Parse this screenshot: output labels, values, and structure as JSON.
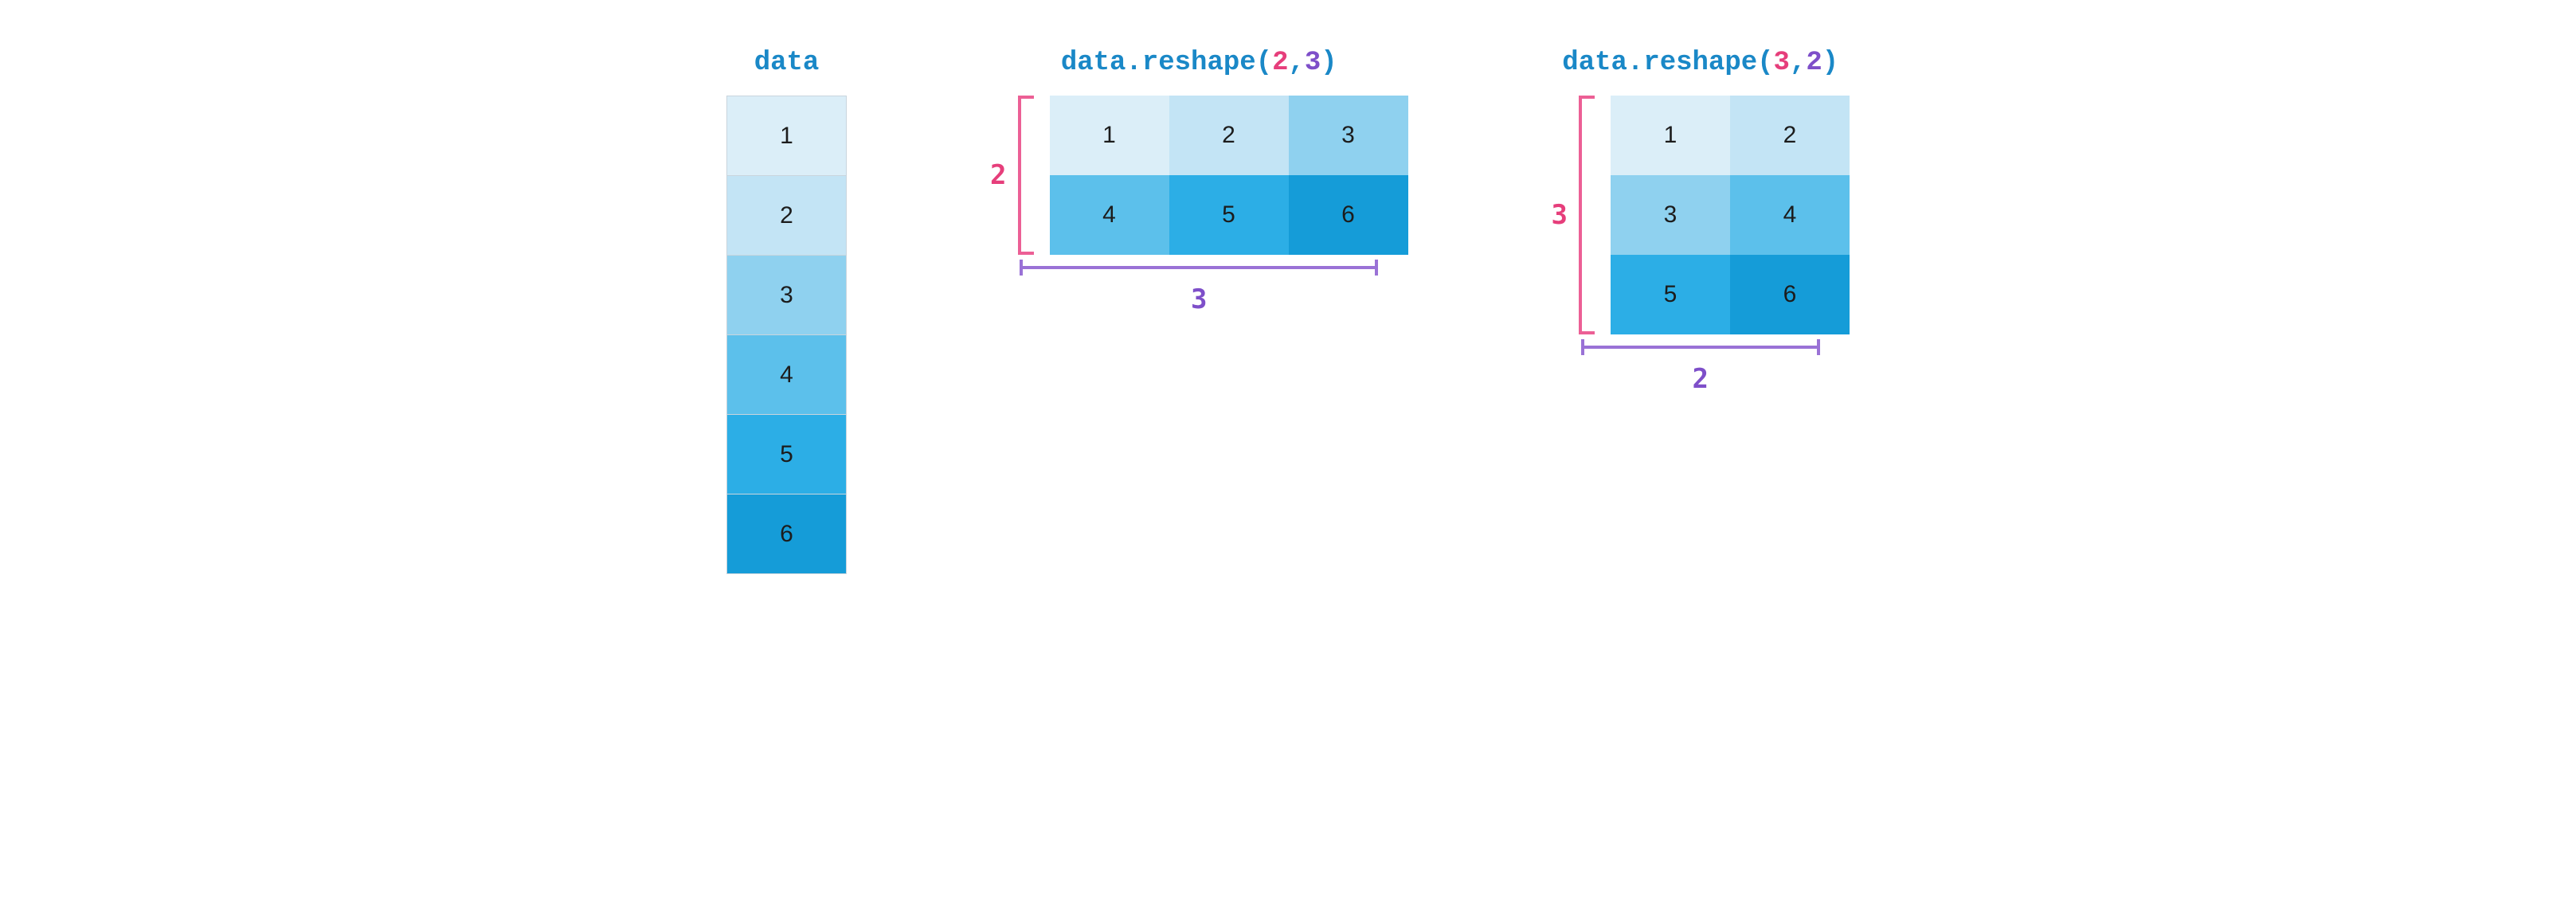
{
  "palette": {
    "code_blue": "#1a88c7",
    "pink": "#e63e7b",
    "purple": "#7e4fc9",
    "shades": [
      "#dbeef8",
      "#c3e4f5",
      "#8fd1ef",
      "#5cc0eb",
      "#2caee6",
      "#159cd8"
    ]
  },
  "panel1": {
    "title": "data",
    "values": [
      "1",
      "2",
      "3",
      "4",
      "5",
      "6"
    ]
  },
  "panel2": {
    "title_prefix": "data.reshape(",
    "arg1": "2",
    "sep": ",",
    "arg2": "3",
    "title_suffix": ")",
    "rows_label": "2",
    "cols_label": "3",
    "rows": 2,
    "cols": 3,
    "values": [
      "1",
      "2",
      "3",
      "4",
      "5",
      "6"
    ]
  },
  "panel3": {
    "title_prefix": "data.reshape(",
    "arg1": "3",
    "sep": ",",
    "arg2": "2",
    "title_suffix": ")",
    "rows_label": "3",
    "cols_label": "2",
    "rows": 3,
    "cols": 2,
    "values": [
      "1",
      "2",
      "3",
      "4",
      "5",
      "6"
    ]
  }
}
